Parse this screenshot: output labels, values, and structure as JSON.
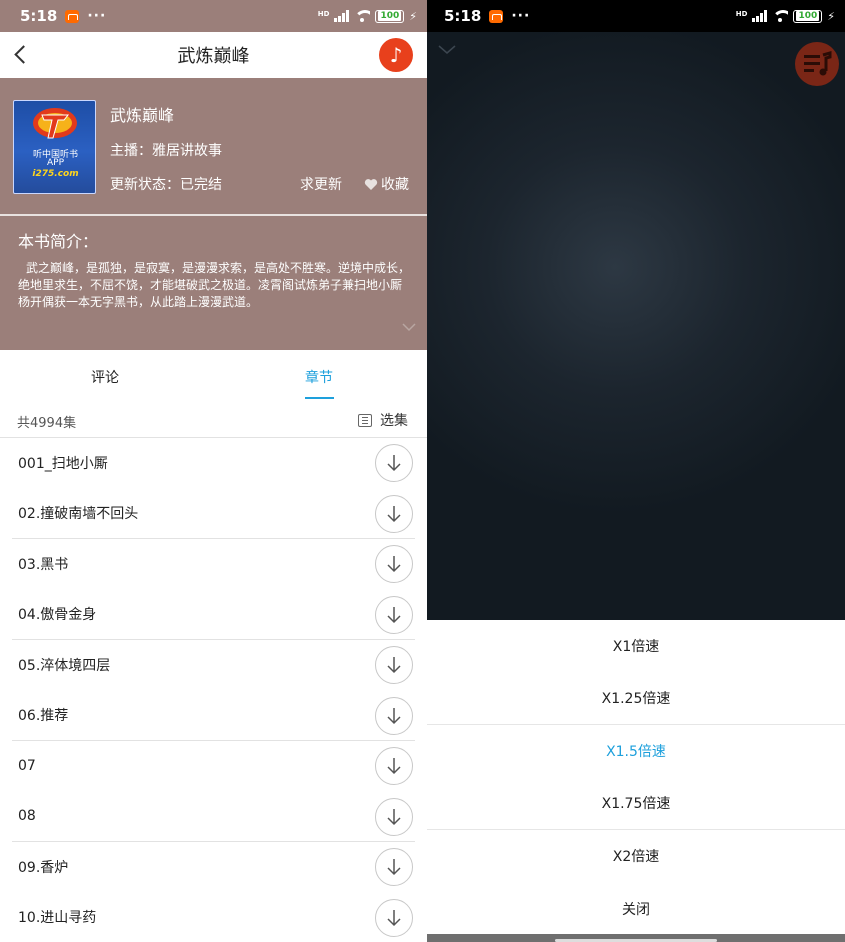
{
  "status_left": {
    "time": "5:18",
    "dots": "···",
    "battery": "100",
    "network": "HD"
  },
  "status_right": {
    "time": "5:18",
    "dots": "···",
    "battery": "100",
    "network": "HD"
  },
  "header": {
    "title": "武炼巅峰"
  },
  "book": {
    "name": "武炼巅峰",
    "host": "主播：雅居讲故事",
    "state": "更新状态：已完结",
    "request_update": "求更新",
    "favorite": "收藏",
    "cover": {
      "line1": "听中国听书",
      "line2": "APP",
      "line3": "i275.com"
    },
    "intro_title": "本书简介：",
    "intro_text": "武之巅峰，是孤独，是寂寞，是漫漫求索，是高处不胜寒。逆境中成长，绝地里求生，不屈不饶，才能堪破武之极道。凌霄阁试炼弟子兼扫地小厮杨开偶获一本无字黑书，从此踏上漫漫武道。"
  },
  "tabs": {
    "comment": "评论",
    "chapter": "章节",
    "active": "chapter"
  },
  "chapters": {
    "count_text": "共4994集",
    "select_label": "选集",
    "items": [
      {
        "title": "001_扫地小厮"
      },
      {
        "title": "02.撞破南墙不回头"
      },
      {
        "title": "03.黑书"
      },
      {
        "title": "04.傲骨金身"
      },
      {
        "title": "05.淬体境四层"
      },
      {
        "title": "06.推荐"
      },
      {
        "title": "07"
      },
      {
        "title": "08"
      },
      {
        "title": "09.香炉"
      },
      {
        "title": "10.进山寻药"
      }
    ]
  },
  "speed_menu": {
    "items": [
      {
        "label": "X1倍速"
      },
      {
        "label": "X1.25倍速"
      },
      {
        "label": "X1.5倍速"
      },
      {
        "label": "X1.75倍速"
      },
      {
        "label": "X2倍速"
      },
      {
        "label": "关闭"
      }
    ],
    "selected_index": 2
  },
  "colors": {
    "accent": "#1ea0dc",
    "panel": "#9b7f7a",
    "music": "#e8401c"
  },
  "icons": [
    "back-icon",
    "music-note-icon",
    "heart-icon",
    "list-icon",
    "download-icon",
    "chevron-down-icon",
    "playlist-icon"
  ]
}
